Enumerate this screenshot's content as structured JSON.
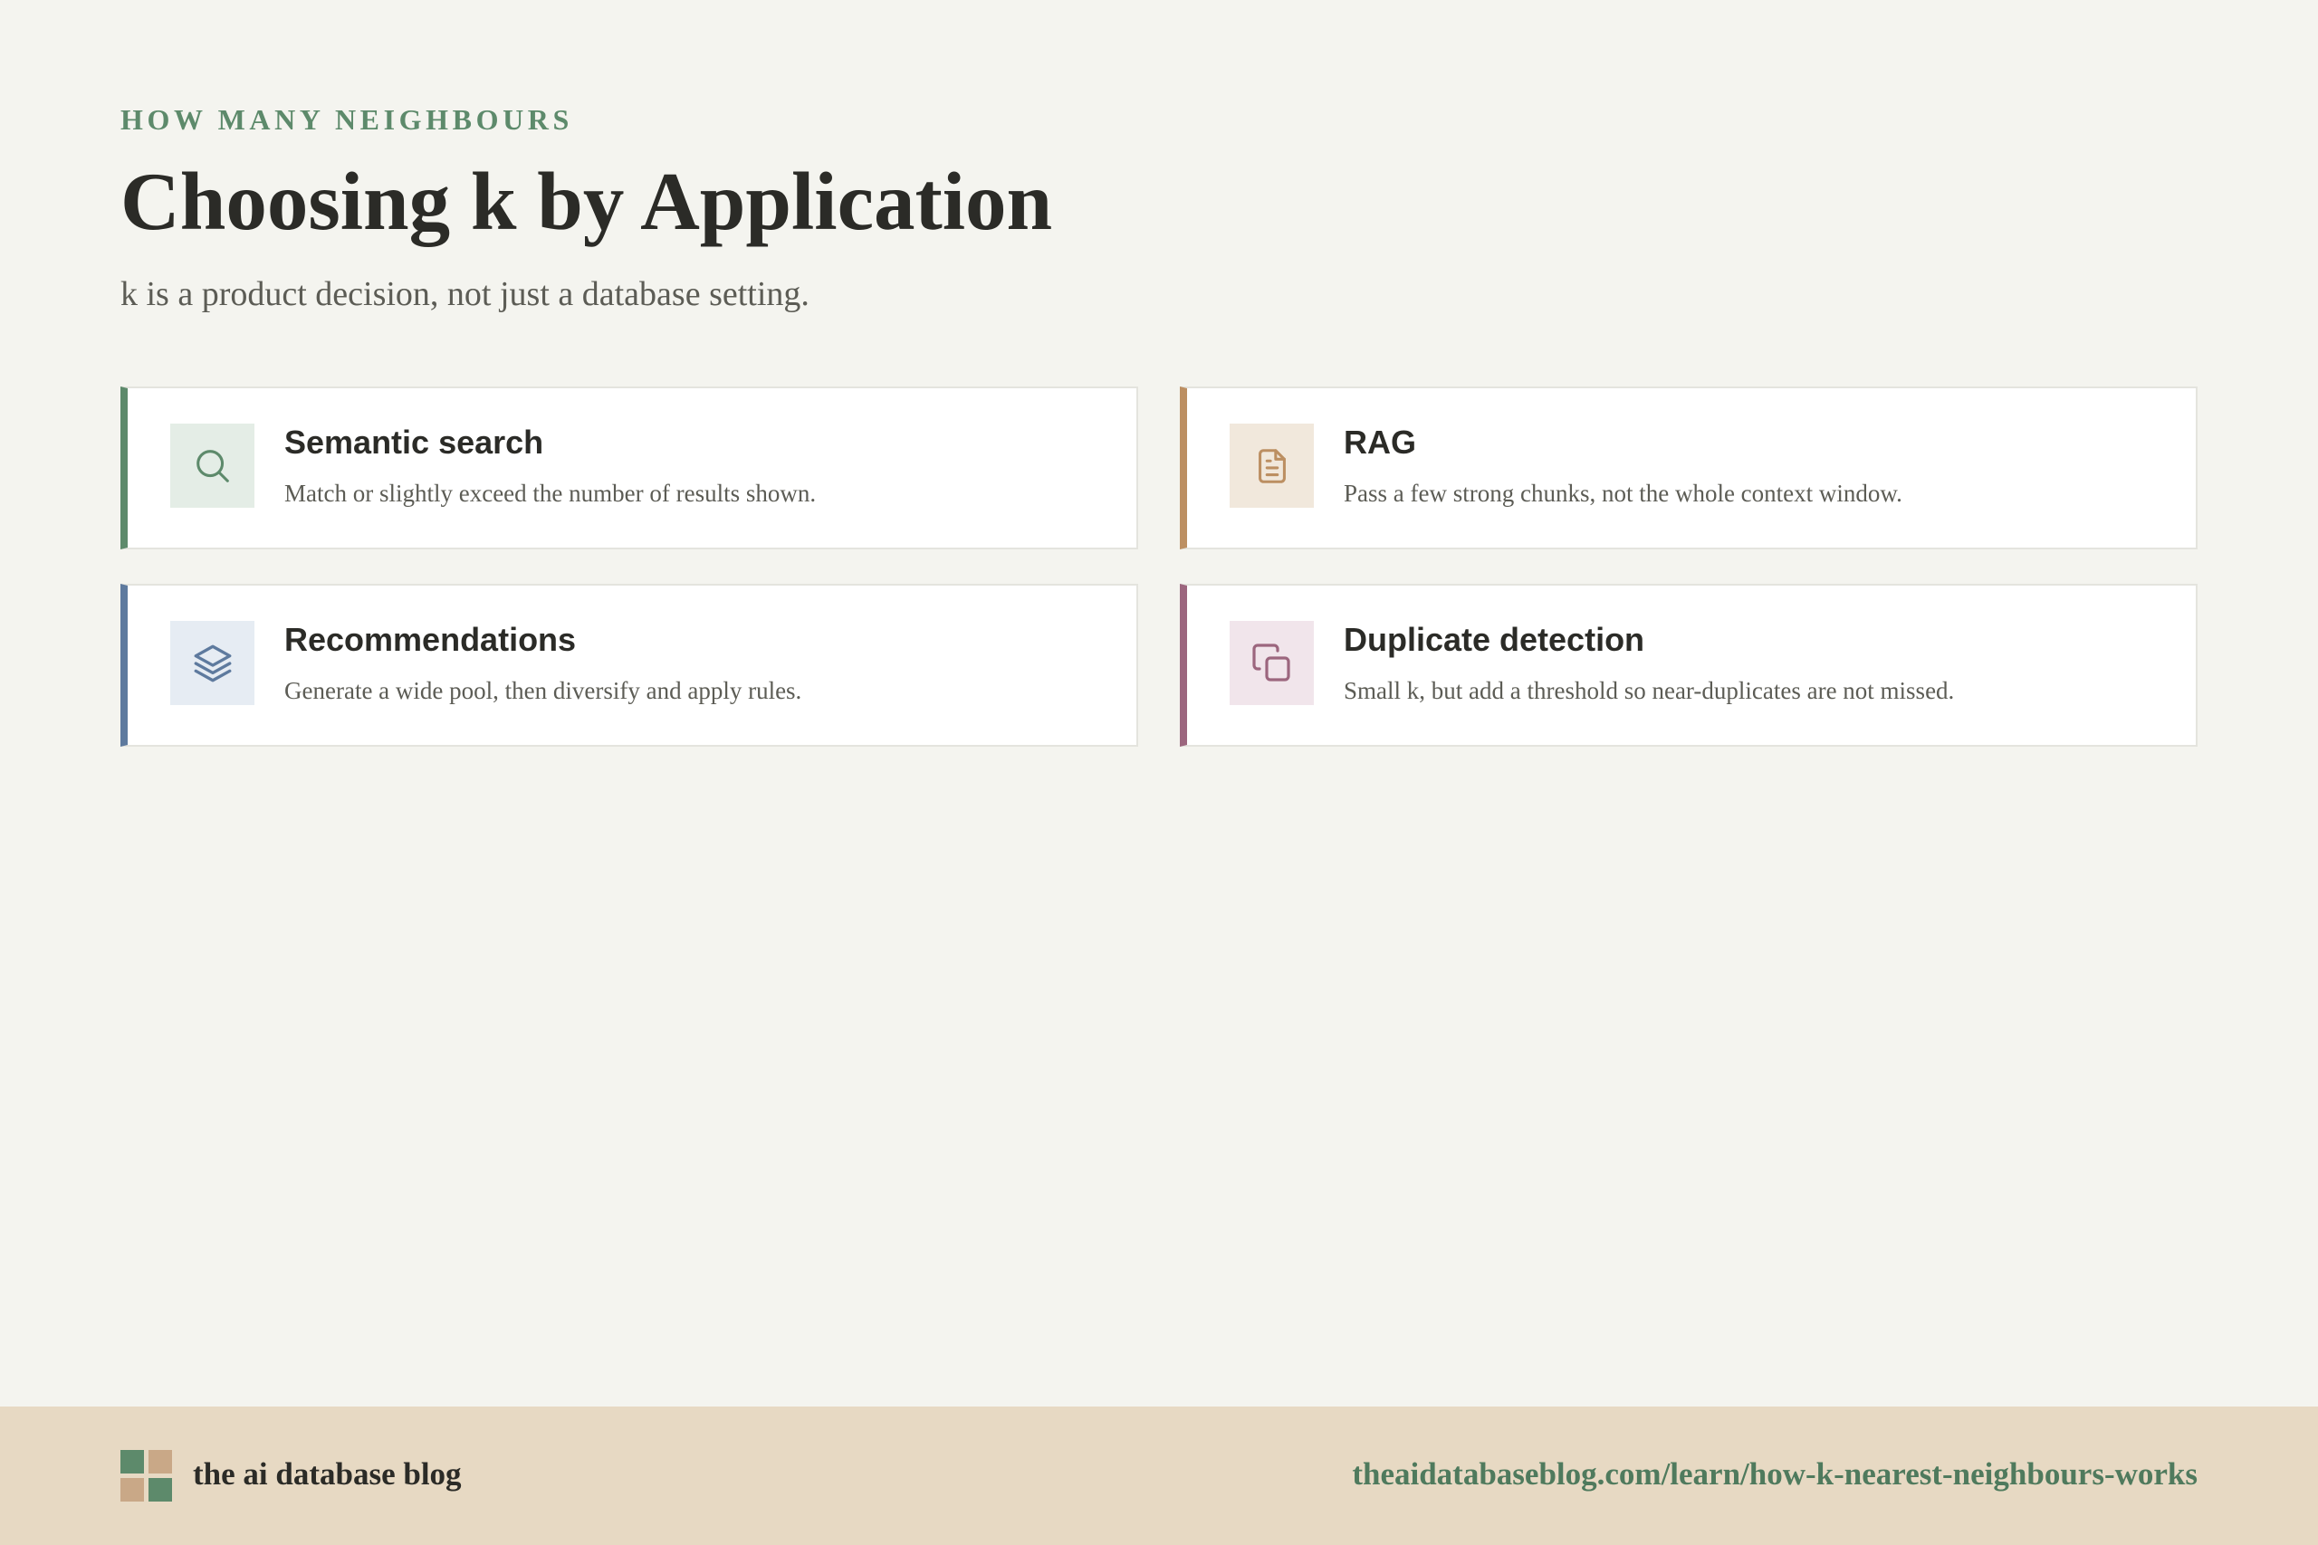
{
  "header": {
    "eyebrow": "HOW MANY NEIGHBOURS",
    "title": "Choosing k by Application",
    "subtitle": "k is a product decision, not just a database setting."
  },
  "cards": [
    {
      "title": "Semantic search",
      "description": "Match or slightly exceed the number of results shown.",
      "icon": "search-icon",
      "accent": "#5d8a6b"
    },
    {
      "title": "RAG",
      "description": "Pass a few strong chunks, not the whole context window.",
      "icon": "document-icon",
      "accent": "#bc8f62"
    },
    {
      "title": "Recommendations",
      "description": "Generate a wide pool, then diversify and apply rules.",
      "icon": "layers-icon",
      "accent": "#5e7a9e"
    },
    {
      "title": "Duplicate detection",
      "description": "Small k, but add a threshold so near-duplicates are not missed.",
      "icon": "copy-icon",
      "accent": "#9c667e"
    }
  ],
  "footer": {
    "brand": "the ai database blog",
    "url": "theaidatabaseblog.com/learn/how-k-nearest-neighbours-works",
    "logo_icon": "grid-logo-icon"
  },
  "colors": {
    "background": "#f4f4ef",
    "footer_background": "#e7d9c3",
    "eyebrow": "#5d8a6b",
    "text": "#2b2b27",
    "muted_text": "#5c5c55"
  }
}
